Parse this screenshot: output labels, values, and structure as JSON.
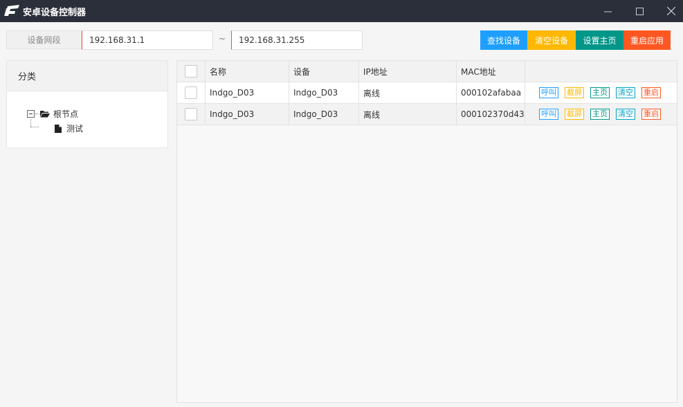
{
  "window": {
    "title": "安卓设备控制器"
  },
  "toolbar": {
    "segment_label": "设备网段",
    "ip_start": "192.168.31.1",
    "separator": "~",
    "ip_end": "192.168.31.255",
    "buttons": [
      {
        "label": "查找设备",
        "color": "#1e9fff"
      },
      {
        "label": "清空设备",
        "color": "#ffb800"
      },
      {
        "label": "设置主页",
        "color": "#009688"
      },
      {
        "label": "重启应用",
        "color": "#ff5722"
      }
    ]
  },
  "sidebar": {
    "title": "分类",
    "tree": {
      "root": "根节点",
      "children": [
        "测试"
      ]
    }
  },
  "table": {
    "headers": [
      "名称",
      "设备",
      "IP地址",
      "MAC地址"
    ],
    "rows": [
      {
        "name": "Indgo_D03",
        "device": "Indgo_D03",
        "ip": "离线",
        "mac": "000102afabaa"
      },
      {
        "name": "Indgo_D03",
        "device": "Indgo_D03",
        "ip": "离线",
        "mac": "000102370d43"
      }
    ],
    "actions": [
      {
        "label": "呼叫",
        "color": "#1e9fff"
      },
      {
        "label": "截屏",
        "color": "#ffb800"
      },
      {
        "label": "主页",
        "color": "#009688"
      },
      {
        "label": "清空",
        "color": "#00a2c9"
      },
      {
        "label": "重启",
        "color": "#ff5722"
      }
    ]
  }
}
